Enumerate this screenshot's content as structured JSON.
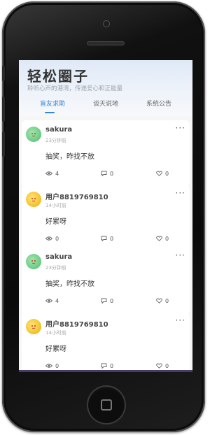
{
  "app": {
    "title": "轻松圈子",
    "subtitle": "聆听心声的港湾，传递爱心和正能量"
  },
  "tabs": [
    {
      "label": "盲友求助",
      "active": true
    },
    {
      "label": "谈天说地",
      "active": false
    },
    {
      "label": "系统公告",
      "active": false
    }
  ],
  "posts": [
    {
      "user": "sakura",
      "time": "23分钟前",
      "body": "抽奖，昨找不放",
      "views": "4",
      "comments": "0",
      "likes": "0",
      "avatar": "green"
    },
    {
      "user": "用户8819769810",
      "time": "14小时前",
      "body": "好累呀",
      "views": "0",
      "comments": "0",
      "likes": "0",
      "avatar": "yellow"
    },
    {
      "user": "sakura",
      "time": "23分钟前",
      "body": "抽奖，昨找不放",
      "views": "4",
      "comments": "0",
      "likes": "0",
      "avatar": "green"
    },
    {
      "user": "用户8819769810",
      "time": "14小时前",
      "body": "好累呀",
      "views": "0",
      "comments": "0",
      "likes": "0",
      "avatar": "yellow"
    }
  ],
  "icons": {
    "more": "more-dots-icon",
    "views": "eye-icon",
    "comments": "comment-icon",
    "likes": "heart-icon"
  },
  "colors": {
    "accent": "#2e87d8",
    "avatar_green": "#6fcf87",
    "avatar_yellow": "#f5c530"
  }
}
